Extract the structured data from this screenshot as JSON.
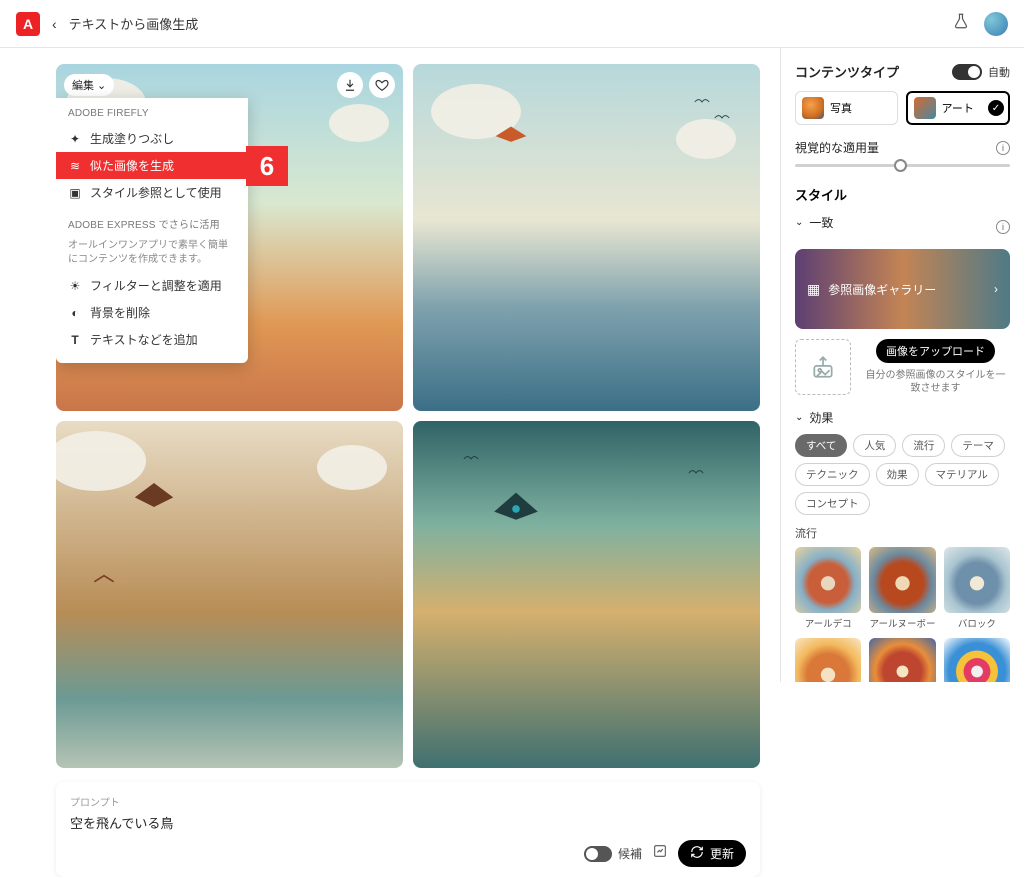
{
  "header": {
    "title": "テキストから画像生成"
  },
  "edit_menu": {
    "button": "編集",
    "section1": "ADOBE FIREFLY",
    "items1": [
      "生成塗りつぶし",
      "似た画像を生成",
      "スタイル参照として使用"
    ],
    "section2": "ADOBE EXPRESS でさらに活用",
    "sub2": "オールインワンアプリで素早く簡単にコンテンツを作成できます。",
    "items2": [
      "フィルターと調整を適用",
      "背景を削除",
      "テキストなどを追加"
    ]
  },
  "callout": "6",
  "prompt": {
    "label": "プロンプト",
    "text": "空を飛んでいる鳥",
    "suggest": "候補",
    "update": "更新"
  },
  "side": {
    "content_type": "コンテンツタイプ",
    "auto": "自動",
    "types": {
      "photo": "写真",
      "art": "アート"
    },
    "visual_intensity": "視覚的な適用量",
    "style": "スタイル",
    "match": "一致",
    "gallery": "参照画像ギャラリー",
    "upload": "画像をアップロード",
    "upload_hint": "自分の参照画像のスタイルを一致させます",
    "effects": "効果",
    "chips": [
      "すべて",
      "人気",
      "流行",
      "テーマ",
      "テクニック",
      "効果",
      "マテリアル",
      "コンセプト"
    ],
    "trend": "流行",
    "styles": [
      "アールデコ",
      "アールヌーボー",
      "バロック"
    ]
  }
}
